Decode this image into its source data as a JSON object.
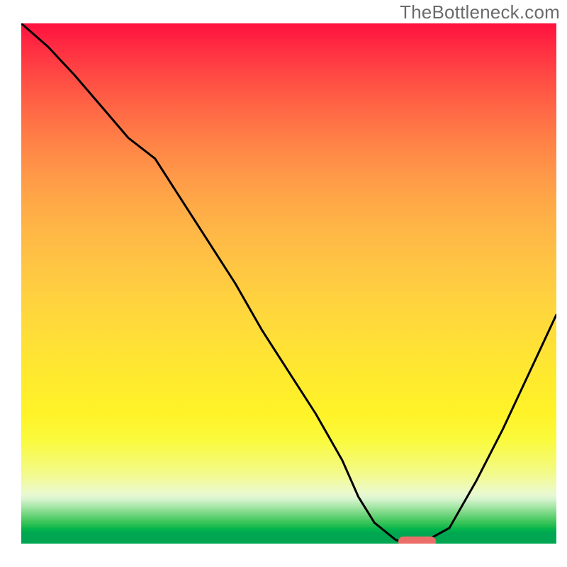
{
  "watermark": "TheBottleneck.com",
  "chart_data": {
    "type": "line",
    "title": "",
    "xlabel": "",
    "ylabel": "",
    "xlim": [
      0,
      100
    ],
    "ylim": [
      0,
      100
    ],
    "x": [
      0,
      5,
      10,
      15,
      20,
      25,
      30,
      35,
      40,
      45,
      50,
      55,
      60,
      63,
      66,
      70,
      72,
      75,
      80,
      85,
      90,
      95,
      100
    ],
    "y": [
      100,
      95.5,
      90,
      84,
      78,
      74,
      66,
      58,
      50,
      41,
      33,
      25,
      16,
      9,
      4,
      0.7,
      0.2,
      0.2,
      3,
      12,
      22,
      33,
      44
    ],
    "series_name": "bottleneck-curve",
    "marker": {
      "x_start": 70.5,
      "x_end": 77.5,
      "y": 0
    },
    "gradient_stops": [
      {
        "pos": 0.0,
        "color": "#ff1440"
      },
      {
        "pos": 0.1,
        "color": "#ff4944"
      },
      {
        "pos": 0.2,
        "color": "#ff7646"
      },
      {
        "pos": 0.3,
        "color": "#ff9b48"
      },
      {
        "pos": 0.4,
        "color": "#ffb746"
      },
      {
        "pos": 0.5,
        "color": "#ffcc41"
      },
      {
        "pos": 0.6,
        "color": "#ffde38"
      },
      {
        "pos": 0.7,
        "color": "#ffec2c"
      },
      {
        "pos": 0.8,
        "color": "#fafa3c"
      },
      {
        "pos": 0.9,
        "color": "#e9f9d1"
      },
      {
        "pos": 0.94,
        "color": "#6cd47b"
      },
      {
        "pos": 0.98,
        "color": "#00a651"
      },
      {
        "pos": 1.0,
        "color": "#00a651"
      }
    ],
    "marker_color": "#eb6e6b",
    "curve_color": "#000000"
  }
}
